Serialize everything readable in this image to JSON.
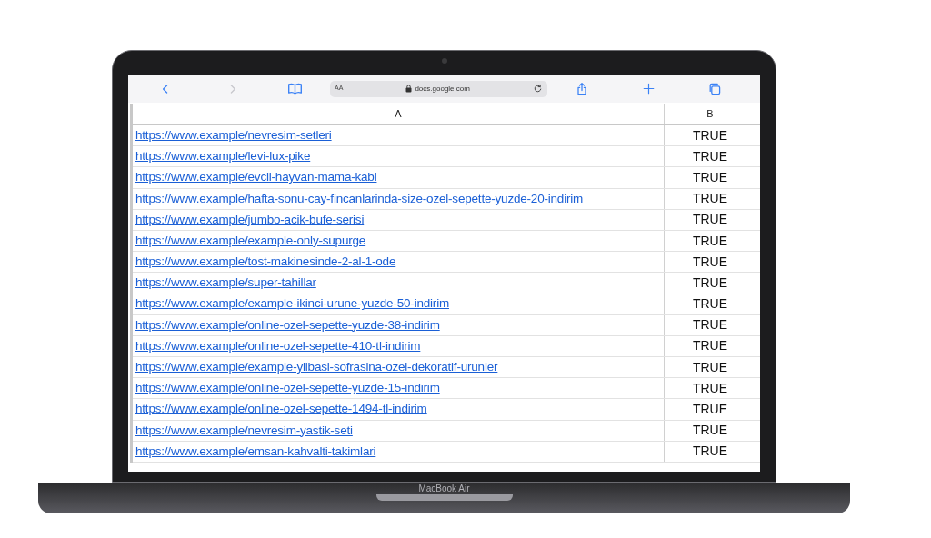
{
  "browser": {
    "nav_buttons": [
      {
        "kind": "back",
        "disabled": false
      },
      {
        "kind": "forward",
        "disabled": true
      }
    ],
    "text_size_button": "AA",
    "address": "docs.google.com"
  },
  "sheet": {
    "columns": [
      "A",
      "B"
    ],
    "rows": [
      {
        "url": "https://www.example/nevresim-setleri",
        "value": "TRUE"
      },
      {
        "url": "https://www.example/levi-lux-pike",
        "value": "TRUE"
      },
      {
        "url": "https://www.example/evcil-hayvan-mama-kabi",
        "value": "TRUE"
      },
      {
        "url": "https://www.example/hafta-sonu-cay-fincanlarinda-size-ozel-sepette-yuzde-20-indirim",
        "value": "TRUE"
      },
      {
        "url": "https://www.example/jumbo-acik-bufe-serisi",
        "value": "TRUE"
      },
      {
        "url": "https://www.example/example-only-supurge",
        "value": "TRUE"
      },
      {
        "url": "https://www.example/tost-makinesinde-2-al-1-ode",
        "value": "TRUE"
      },
      {
        "url": "https://www.example/super-tahillar",
        "value": "TRUE"
      },
      {
        "url": "https://www.example/example-ikinci-urune-yuzde-50-indirim",
        "value": "TRUE"
      },
      {
        "url": "https://www.example/online-ozel-sepette-yuzde-38-indirim",
        "value": "TRUE"
      },
      {
        "url": "https://www.example/online-ozel-sepette-410-tl-indirim",
        "value": "TRUE"
      },
      {
        "url": "https://www.example/example-yilbasi-sofrasina-ozel-dekoratif-urunler",
        "value": "TRUE"
      },
      {
        "url": "https://www.example/online-ozel-sepette-yuzde-15-indirim",
        "value": "TRUE"
      },
      {
        "url": "https://www.example/online-ozel-sepette-1494-tl-indirim",
        "value": "TRUE"
      },
      {
        "url": "https://www.example/nevresim-yastik-seti",
        "value": "TRUE"
      },
      {
        "url": "https://www.example/emsan-kahvalti-takimlari",
        "value": "TRUE"
      }
    ]
  },
  "laptop": {
    "label": "MacBook Air"
  }
}
